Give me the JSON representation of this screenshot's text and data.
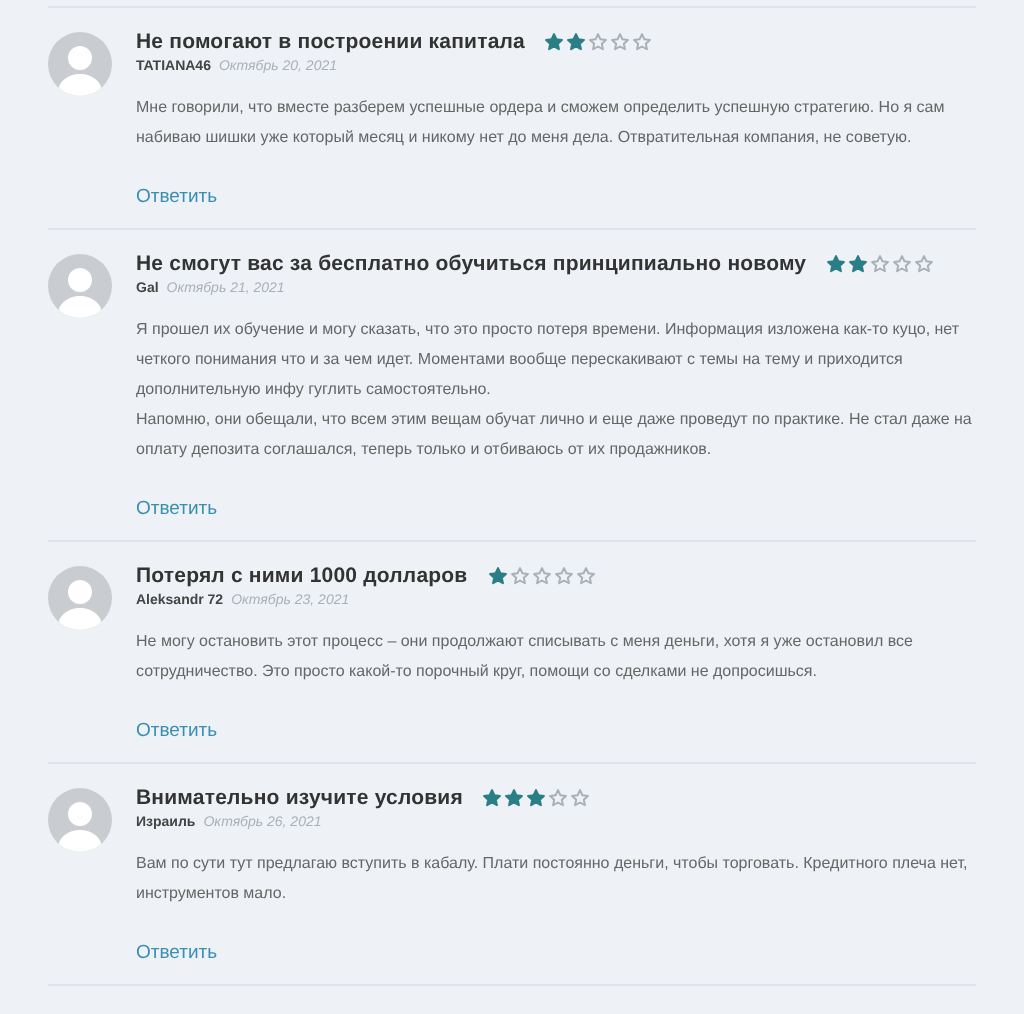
{
  "reviews": [
    {
      "title": "Не помогают в построении капитала",
      "stars": 2,
      "author": "TATIANA46",
      "date": "Октябрь 20, 2021",
      "paragraphs": [
        "Мне говорили, что вместе разберем успешные ордера и сможем определить успешную стратегию. Но я сам набиваю шишки уже который месяц и никому нет до меня дела. Отвратительная компания, не советую."
      ],
      "reply": "Ответить"
    },
    {
      "title": "Не смогут вас за бесплатно обучиться принципиально новому",
      "stars": 2,
      "author": "Gal",
      "date": "Октябрь 21, 2021",
      "paragraphs": [
        "Я прошел их обучение и могу сказать, что это просто потеря времени. Информация изложена как-то куцо, нет четкого понимания что и за чем идет. Моментами вообще перескакивают с темы на тему и приходится дополнительную инфу гуглить самостоятельно.",
        "Напомню, они обещали, что всем этим вещам обучат лично и еще даже проведут по практике. Не стал даже на оплату депозита соглашался, теперь только и отбиваюсь от их продажников."
      ],
      "reply": "Ответить"
    },
    {
      "title": "Потерял с ними 1000 долларов",
      "stars": 1,
      "author": "Aleksandr 72",
      "date": "Октябрь 23, 2021",
      "paragraphs": [
        "Не могу остановить этот процесс – они продолжают списывать с меня деньги, хотя я уже остановил все сотрудничество. Это просто какой-то порочный круг, помощи со сделками не допросишься."
      ],
      "reply": "Ответить"
    },
    {
      "title": "Внимательно изучите условия",
      "stars": 3,
      "author": "Израиль",
      "date": "Октябрь 26, 2021",
      "paragraphs": [
        "Вам по сути тут предлагаю вступить в кабалу. Плати постоянно деньги, чтобы торговать. Кредитного плеча нет, инструментов мало."
      ],
      "reply": "Ответить"
    }
  ]
}
